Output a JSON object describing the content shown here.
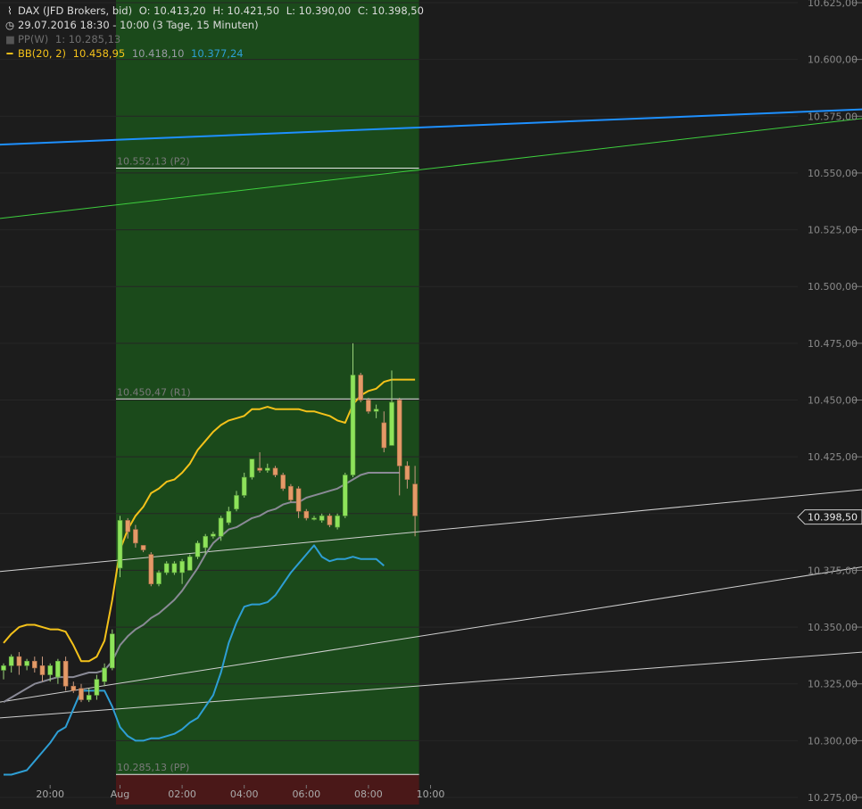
{
  "header": {
    "title": "DAX (JFD Brokers, bid)",
    "ohlc": [
      "O: 10.413,20",
      "H: 10.421,50",
      "L: 10.390,00",
      "C: 10.398,50"
    ],
    "period": "29.07.2016 18:30 - 10:00 (3 Tage, 15 Minuten)",
    "pp_label": "PP(W)",
    "pp_value": "1: 10.285,13",
    "bb_label": "BB(20, 2)",
    "bb_upper": "10.458,95",
    "bb_mid": "10.418,10",
    "bb_lower": "10.377,24"
  },
  "colors": {
    "background": "#1c1c1c",
    "session_shade": "#1b4a1b",
    "up_candle": "#8ee35a",
    "down_candle": "#e49a67",
    "bb_upper": "#f4c21a",
    "bb_mid": "#8a8a96",
    "bb_lower": "#2e9ed4",
    "trend_blue": "#1e90ff",
    "trend_green": "#3ecf3e",
    "support_lines": "#d0d0d0",
    "pivot_lines": "#e6e6e6",
    "pp_band": "#4a1818"
  },
  "chart_data": {
    "type": "candlestick",
    "yaxis": {
      "ylim": [
        10275,
        10625
      ],
      "ticks": [
        "10.625,00",
        "10.600,00",
        "10.575,00",
        "10.550,00",
        "10.525,00",
        "10.500,00",
        "10.475,00",
        "10.450,00",
        "10.425,00",
        "10.400,00",
        "10.375,00",
        "10.350,00",
        "10.325,00",
        "10.300,00",
        "10.275,00"
      ],
      "tick_values": [
        10625,
        10600,
        10575,
        10550,
        10525,
        10500,
        10475,
        10450,
        10425,
        10400,
        10375,
        10350,
        10325,
        10300,
        10275
      ],
      "last_price_label": "10.398,50",
      "last_price": 10398.5
    },
    "xaxis": {
      "tick_labels": [
        "20:00",
        "Aug",
        "02:00",
        "04:00",
        "06:00",
        "08:00",
        "10:00"
      ],
      "tick_bars": [
        6,
        15,
        23,
        31,
        39,
        47,
        55
      ]
    },
    "pivots": [
      {
        "label": "10.552,13 (P2)",
        "value": 10552.13
      },
      {
        "label": "10.450,47 (R1)",
        "value": 10450.47
      },
      {
        "label": "10.285,13 (PP)",
        "value": 10285.13
      }
    ],
    "session_start_bar": 15,
    "candles": [
      {
        "o": 10331,
        "h": 10334,
        "l": 10327,
        "c": 10333
      },
      {
        "o": 10333,
        "h": 10338,
        "l": 10330,
        "c": 10337
      },
      {
        "o": 10337,
        "h": 10339,
        "l": 10329,
        "c": 10333
      },
      {
        "o": 10333,
        "h": 10336,
        "l": 10331,
        "c": 10335
      },
      {
        "o": 10335,
        "h": 10337,
        "l": 10330,
        "c": 10332
      },
      {
        "o": 10333,
        "h": 10337,
        "l": 10326,
        "c": 10329
      },
      {
        "o": 10329,
        "h": 10334,
        "l": 10326,
        "c": 10333
      },
      {
        "o": 10328,
        "h": 10336,
        "l": 10325,
        "c": 10335
      },
      {
        "o": 10335,
        "h": 10337,
        "l": 10322,
        "c": 10324
      },
      {
        "o": 10324,
        "h": 10326,
        "l": 10321,
        "c": 10322
      },
      {
        "o": 10323,
        "h": 10325,
        "l": 10317,
        "c": 10318
      },
      {
        "o": 10318,
        "h": 10323,
        "l": 10317,
        "c": 10320
      },
      {
        "o": 10320,
        "h": 10329,
        "l": 10318,
        "c": 10327
      },
      {
        "o": 10326,
        "h": 10334,
        "l": 10324,
        "c": 10332
      },
      {
        "o": 10332,
        "h": 10349,
        "l": 10331,
        "c": 10347
      },
      {
        "o": 10376,
        "h": 10399,
        "l": 10372,
        "c": 10397
      },
      {
        "o": 10397,
        "h": 10398,
        "l": 10389,
        "c": 10392
      },
      {
        "o": 10393,
        "h": 10395,
        "l": 10385,
        "c": 10387
      },
      {
        "o": 10386,
        "h": 10386,
        "l": 10383,
        "c": 10384
      },
      {
        "o": 10382,
        "h": 10383,
        "l": 10368,
        "c": 10369
      },
      {
        "o": 10369,
        "h": 10375,
        "l": 10368,
        "c": 10374
      },
      {
        "o": 10374,
        "h": 10379,
        "l": 10373,
        "c": 10378
      },
      {
        "o": 10374,
        "h": 10379,
        "l": 10373,
        "c": 10378
      },
      {
        "o": 10374,
        "h": 10380,
        "l": 10369,
        "c": 10379
      },
      {
        "o": 10375,
        "h": 10382,
        "l": 10375,
        "c": 10381
      },
      {
        "o": 10381,
        "h": 10388,
        "l": 10380,
        "c": 10387
      },
      {
        "o": 10385,
        "h": 10391,
        "l": 10382,
        "c": 10390
      },
      {
        "o": 10390,
        "h": 10392,
        "l": 10389,
        "c": 10391
      },
      {
        "o": 10390,
        "h": 10399,
        "l": 10388,
        "c": 10398
      },
      {
        "o": 10396,
        "h": 10403,
        "l": 10395,
        "c": 10401
      },
      {
        "o": 10402,
        "h": 10410,
        "l": 10401,
        "c": 10408
      },
      {
        "o": 10408,
        "h": 10418,
        "l": 10407,
        "c": 10416
      },
      {
        "o": 10416,
        "h": 10424,
        "l": 10415,
        "c": 10424
      },
      {
        "o": 10420,
        "h": 10427,
        "l": 10418,
        "c": 10419
      },
      {
        "o": 10419,
        "h": 10422,
        "l": 10418,
        "c": 10420
      },
      {
        "o": 10420,
        "h": 10421,
        "l": 10416,
        "c": 10417
      },
      {
        "o": 10417,
        "h": 10418,
        "l": 10410,
        "c": 10411
      },
      {
        "o": 10412,
        "h": 10413,
        "l": 10405,
        "c": 10406
      },
      {
        "o": 10411,
        "h": 10412,
        "l": 10398,
        "c": 10401
      },
      {
        "o": 10401,
        "h": 10402,
        "l": 10397,
        "c": 10398
      },
      {
        "o": 10398,
        "h": 10399,
        "l": 10397,
        "c": 10398
      },
      {
        "o": 10397,
        "h": 10400,
        "l": 10396,
        "c": 10399
      },
      {
        "o": 10399,
        "h": 10400,
        "l": 10394,
        "c": 10395
      },
      {
        "o": 10394,
        "h": 10400,
        "l": 10393,
        "c": 10399
      },
      {
        "o": 10399,
        "h": 10418,
        "l": 10398,
        "c": 10417
      },
      {
        "o": 10417,
        "h": 10475,
        "l": 10416,
        "c": 10461
      },
      {
        "o": 10461,
        "h": 10462,
        "l": 10449,
        "c": 10450
      },
      {
        "o": 10450,
        "h": 10451,
        "l": 10444,
        "c": 10445
      },
      {
        "o": 10445,
        "h": 10448,
        "l": 10442,
        "c": 10446
      },
      {
        "o": 10440,
        "h": 10445,
        "l": 10427,
        "c": 10429
      },
      {
        "o": 10430,
        "h": 10463,
        "l": 10430,
        "c": 10449
      },
      {
        "o": 10450,
        "h": 10451,
        "l": 10408,
        "c": 10421
      },
      {
        "o": 10421,
        "h": 10423,
        "l": 10411,
        "c": 10415
      },
      {
        "o": 10413,
        "h": 10421,
        "l": 10390,
        "c": 10399
      }
    ],
    "series": [
      {
        "name": "BB(20, 2)",
        "part": "upper",
        "values": [
          10343,
          10347,
          10350,
          10351,
          10351,
          10350,
          10349,
          10349,
          10348,
          10342,
          10335,
          10335,
          10337,
          10344,
          10362,
          10384,
          10393,
          10399,
          10403,
          10409,
          10411,
          10414,
          10415,
          10418,
          10422,
          10428,
          10432,
          10436,
          10439,
          10441,
          10442,
          10443,
          10446,
          10446,
          10447,
          10446,
          10446,
          10446,
          10446,
          10445,
          10445,
          10444,
          10443,
          10441,
          10440,
          10448,
          10452,
          10454,
          10455,
          10458,
          10459,
          10459,
          10459,
          10459
        ]
      },
      {
        "name": "BB(20, 2)",
        "part": "mid",
        "values": [
          10317,
          10319,
          10321,
          10323,
          10325,
          10326,
          10327,
          10328,
          10328,
          10328,
          10329,
          10330,
          10330,
          10331,
          10335,
          10342,
          10346,
          10349,
          10351,
          10354,
          10356,
          10359,
          10362,
          10366,
          10371,
          10376,
          10382,
          10387,
          10390,
          10393,
          10394,
          10396,
          10398,
          10399,
          10401,
          10402,
          10404,
          10405,
          10405,
          10407,
          10408,
          10409,
          10410,
          10411,
          10413,
          10415,
          10417,
          10418,
          10418,
          10418,
          10418,
          10418
        ]
      },
      {
        "name": "BB(20, 2)",
        "part": "lower",
        "values": [
          10285,
          10285,
          10286,
          10287,
          10291,
          10295,
          10299,
          10304,
          10306,
          10314,
          10322,
          10322,
          10322,
          10322,
          10315,
          10306,
          10302,
          10300,
          10300,
          10301,
          10301,
          10302,
          10303,
          10305,
          10308,
          10310,
          10315,
          10320,
          10330,
          10343,
          10352,
          10359,
          10360,
          10360,
          10361,
          10364,
          10369,
          10374,
          10378,
          10382,
          10386,
          10381,
          10379,
          10380,
          10380,
          10381,
          10380,
          10380,
          10380,
          10377
        ]
      }
    ]
  }
}
